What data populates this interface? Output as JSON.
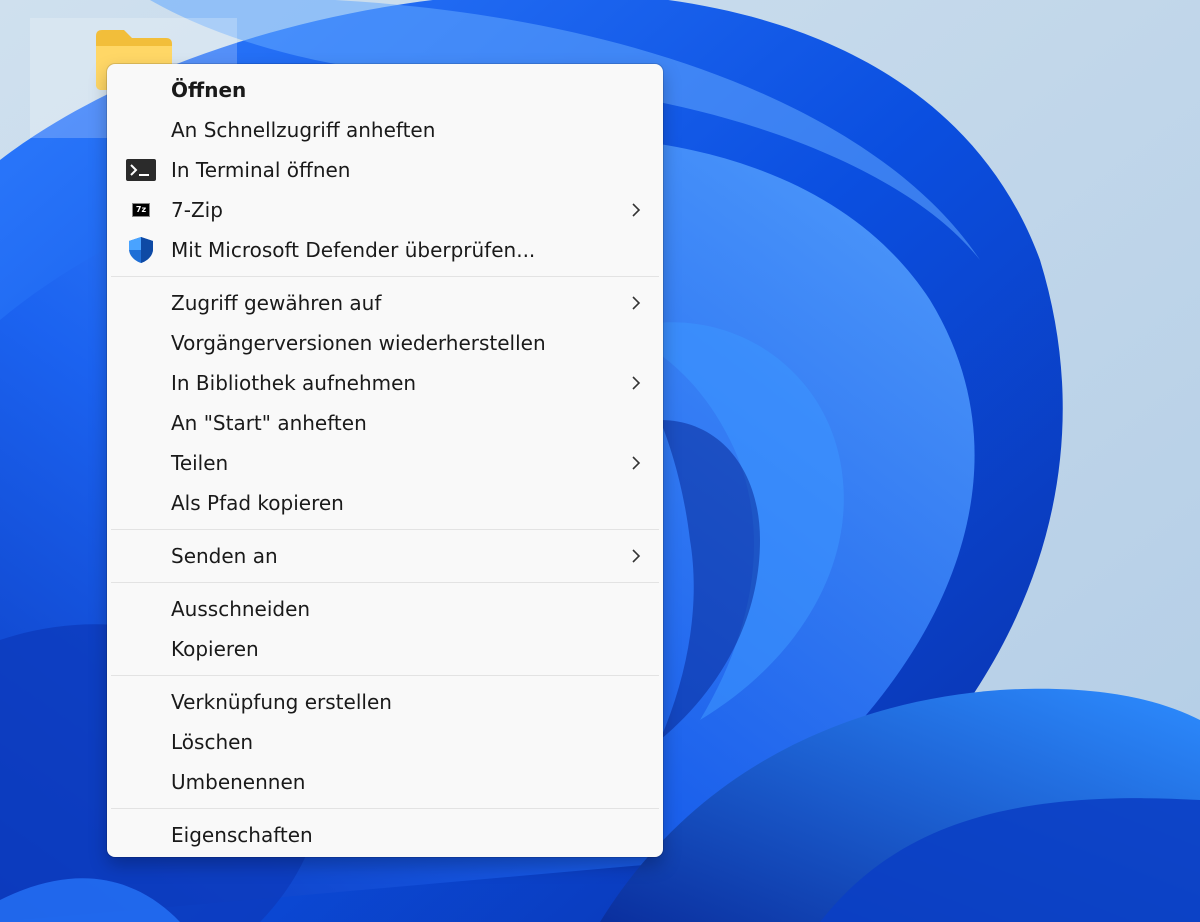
{
  "desktop": {
    "folder_icon": "folder-icon"
  },
  "menu": {
    "groups": [
      {
        "items": [
          {
            "label": "Öffnen",
            "bold": true
          },
          {
            "label": "An Schnellzugriff anheften"
          },
          {
            "label": "In Terminal öffnen",
            "icon": "terminal-icon"
          },
          {
            "label": "7-Zip",
            "icon": "seven-zip-icon",
            "icon_text": "7z",
            "submenu": true
          },
          {
            "label": "Mit Microsoft Defender überprüfen...",
            "icon": "defender-shield-icon"
          }
        ]
      },
      {
        "items": [
          {
            "label": "Zugriff gewähren auf",
            "submenu": true
          },
          {
            "label": "Vorgängerversionen wiederherstellen"
          },
          {
            "label": "In Bibliothek aufnehmen",
            "submenu": true
          },
          {
            "label": "An \"Start\" anheften"
          },
          {
            "label": "Teilen",
            "submenu": true
          },
          {
            "label": "Als Pfad kopieren"
          }
        ]
      },
      {
        "items": [
          {
            "label": "Senden an",
            "submenu": true
          }
        ]
      },
      {
        "items": [
          {
            "label": "Ausschneiden"
          },
          {
            "label": "Kopieren"
          }
        ]
      },
      {
        "items": [
          {
            "label": "Verknüpfung erstellen"
          },
          {
            "label": "Löschen"
          },
          {
            "label": "Umbenennen"
          }
        ]
      },
      {
        "items": [
          {
            "label": "Eigenschaften"
          }
        ]
      }
    ]
  },
  "colors": {
    "menu_background": "#f9f9f9",
    "text": "#1a1a1a",
    "separator": "#e3e3e3",
    "wallpaper_blue": "#1454e6",
    "wallpaper_light": "#c9dbe9"
  }
}
